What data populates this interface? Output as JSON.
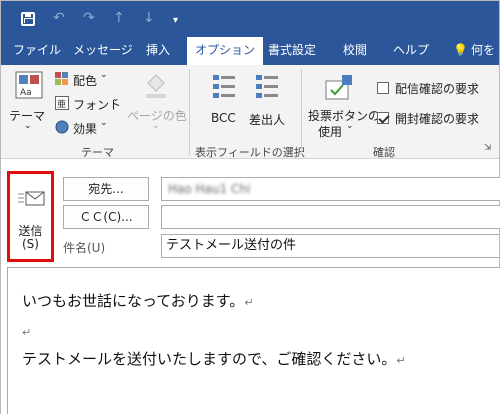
{
  "quick_access": {
    "save_icon": "save-icon",
    "undo_icon": "undo-icon",
    "redo_icon": "redo-icon",
    "up_icon": "arrow-up-icon",
    "down_icon": "arrow-down-icon",
    "customize_icon": "customize-qa-icon"
  },
  "tabs": [
    {
      "label": "ファイル"
    },
    {
      "label": "メッセージ"
    },
    {
      "label": "挿入"
    },
    {
      "label": "オプション"
    },
    {
      "label": "書式設定"
    },
    {
      "label": "校閲"
    },
    {
      "label": "ヘルプ"
    },
    {
      "label": "何を"
    }
  ],
  "ribbon": {
    "theme": {
      "theme_label": "テーマ",
      "colors_label": "配色",
      "fonts_label": "フォント",
      "effects_label": "効果",
      "page_color_label": "ページの色",
      "group_label": "テーマ"
    },
    "fields": {
      "bcc_label": "BCC",
      "from_label": "差出人",
      "group_label": "表示フィールドの選択"
    },
    "tracking": {
      "vote_label_1": "投票ボタンの",
      "vote_label_2": "使用",
      "delivery_receipt_label": "配信確認の要求",
      "read_receipt_label": "開封確認の要求",
      "group_label": "確認"
    },
    "colors": {
      "accent": "#2b579a",
      "highlight": "#e10d0d"
    }
  },
  "message": {
    "send_label_1": "送信",
    "send_label_2": "(S)",
    "to_button": "宛先...",
    "to_value": "Hao Hau1 Chi",
    "cc_button": "ＣＣ(C)...",
    "cc_value": "",
    "subject_label": "件名(U)",
    "subject_value": "テストメール送付の件",
    "body_lines": [
      "いつもお世話になっております。",
      "",
      "テストメールを送付いたしますので、ご確認ください。"
    ],
    "para_mark": "↵"
  }
}
